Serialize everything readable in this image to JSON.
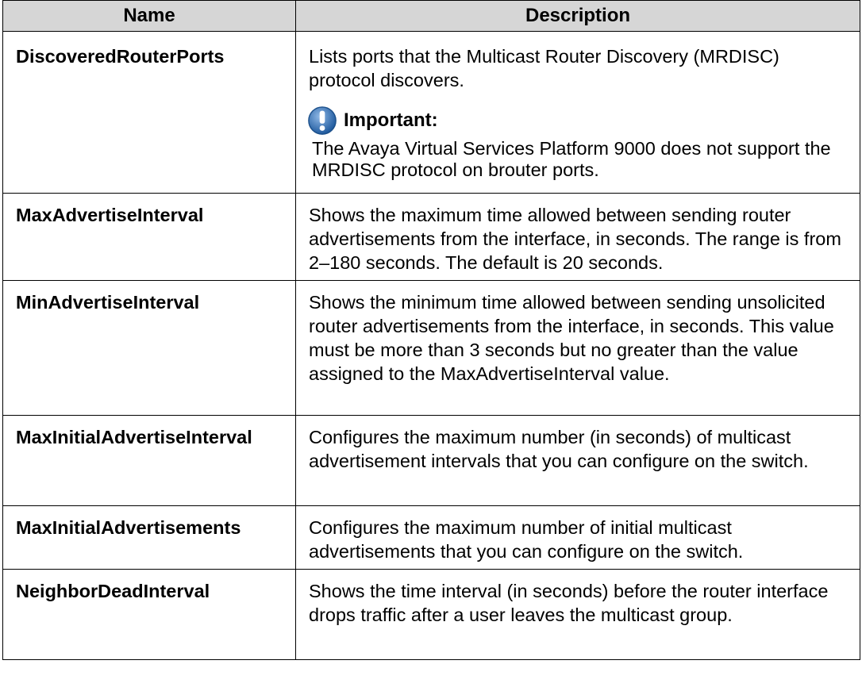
{
  "table": {
    "headers": [
      "Name",
      "Description"
    ],
    "rows": [
      {
        "name": "DiscoveredRouterPorts",
        "description": "Lists ports that the Multicast Router Discovery (MRDISC) protocol discovers.",
        "important_label": "Important:",
        "important_text": "The Avaya Virtual Services Platform 9000 does not support the MRDISC protocol on brouter ports."
      },
      {
        "name": "MaxAdvertiseInterval",
        "description": "Shows the maximum time allowed between sending router advertisements from the interface, in seconds. The range is from 2–180 seconds. The default is 20 seconds."
      },
      {
        "name": "MinAdvertiseInterval",
        "description": "Shows the minimum time allowed between sending unsolicited router advertisements from the interface, in seconds. This value must be more than 3 seconds but no greater than the value assigned to the MaxAdvertiseInterval value."
      },
      {
        "name": "MaxInitialAdvertiseInterval",
        "description": "Configures the maximum number (in seconds) of multicast advertisement intervals that you can configure on the switch."
      },
      {
        "name": "MaxInitialAdvertisements",
        "description": "Configures the maximum number of initial multicast advertisements that you can configure on the switch."
      },
      {
        "name": "NeighborDeadInterval",
        "description": "Shows the time interval (in seconds) before the router interface drops traffic after a user leaves the multicast group."
      }
    ]
  },
  "icons": {
    "important": "exclamation-circle-icon"
  },
  "colors": {
    "header_bg": "#d6d6d6",
    "icon_blue": "#2f6fb0",
    "border": "#000000"
  }
}
